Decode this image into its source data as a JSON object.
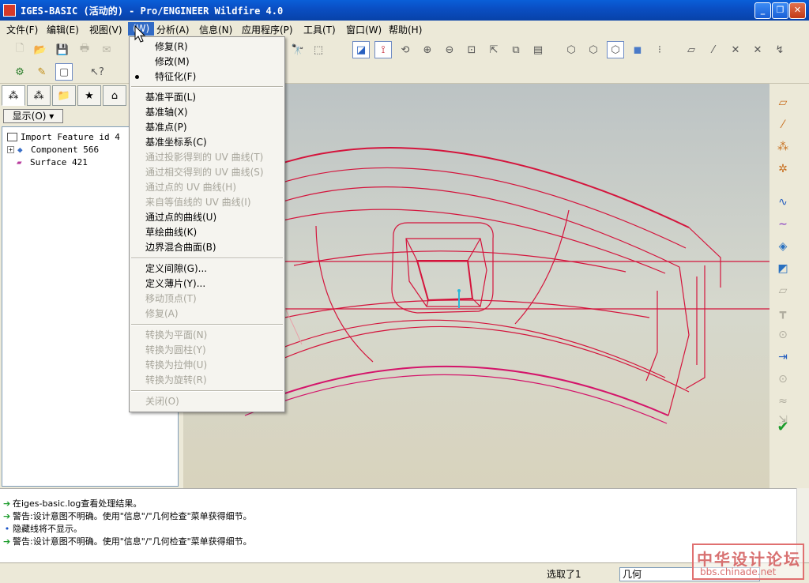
{
  "window": {
    "title": "IGES-BASIC (活动的) - Pro/ENGINEER Wildfire 4.0"
  },
  "menubar": [
    {
      "label": "文件(F)"
    },
    {
      "label": "编辑(E)"
    },
    {
      "label": "视图(V)"
    },
    {
      "label": "(W)"
    },
    {
      "label": "分析(A)"
    },
    {
      "label": "信息(N)"
    },
    {
      "label": "应用程序(P)"
    },
    {
      "label": "工具(T)"
    },
    {
      "label": "窗口(W)"
    },
    {
      "label": "帮助(H)"
    }
  ],
  "dropdown": {
    "items": [
      {
        "label": "修复(R)",
        "enabled": true
      },
      {
        "label": "修改(M)",
        "enabled": true
      },
      {
        "label": "特征化(F)",
        "enabled": true,
        "bullet": true
      },
      {
        "label": "基准平面(L)",
        "enabled": true
      },
      {
        "label": "基准轴(X)",
        "enabled": true
      },
      {
        "label": "基准点(P)",
        "enabled": true
      },
      {
        "label": "基准坐标系(C)",
        "enabled": true
      },
      {
        "label": "通过投影得到的 UV 曲线(T)",
        "enabled": false
      },
      {
        "label": "通过相交得到的 UV 曲线(S)",
        "enabled": false
      },
      {
        "label": "通过点的 UV 曲线(H)",
        "enabled": false
      },
      {
        "label": "来自等值线的 UV 曲线(I)",
        "enabled": false
      },
      {
        "label": "通过点的曲线(U)",
        "enabled": true
      },
      {
        "label": "草绘曲线(K)",
        "enabled": true
      },
      {
        "label": "边界混合曲面(B)",
        "enabled": true
      },
      {
        "label": "定义间隙(G)...",
        "enabled": true
      },
      {
        "label": "定义薄片(Y)...",
        "enabled": true
      },
      {
        "label": "移动顶点(T)",
        "enabled": false
      },
      {
        "label": "修复(A)",
        "enabled": false
      },
      {
        "label": "转换为平面(N)",
        "enabled": false
      },
      {
        "label": "转换为圆柱(Y)",
        "enabled": false
      },
      {
        "label": "转换为拉伸(U)",
        "enabled": false
      },
      {
        "label": "转换为旋转(R)",
        "enabled": false
      },
      {
        "label": "关闭(O)",
        "enabled": false
      }
    ]
  },
  "model_tree": {
    "show_button": "显示(O)",
    "nodes": [
      {
        "label": "Import Feature id 4"
      },
      {
        "label": "Component 566"
      },
      {
        "label": "Surface 421"
      }
    ]
  },
  "messages": [
    {
      "text": "在iges-basic.log查看处理结果。",
      "kind": "arrow"
    },
    {
      "text": "警告:设计意图不明确。使用\"信息\"/\"几何检查\"菜单获得细节。",
      "kind": "arrow"
    },
    {
      "text": "隐藏线将不显示。",
      "kind": "dot"
    },
    {
      "text": "警告:设计意图不明确。使用\"信息\"/\"几何检查\"菜单获得细节。",
      "kind": "arrow"
    }
  ],
  "statusbar": {
    "selection": "选取了1",
    "filter": "几何"
  },
  "watermark": {
    "text": "中华设计论坛",
    "url": "bbs.chinade.net"
  },
  "colors": {
    "model_edge": "#d4143c",
    "menu_highlight": "#316ac5",
    "title_bar": "#0a4fc4"
  }
}
